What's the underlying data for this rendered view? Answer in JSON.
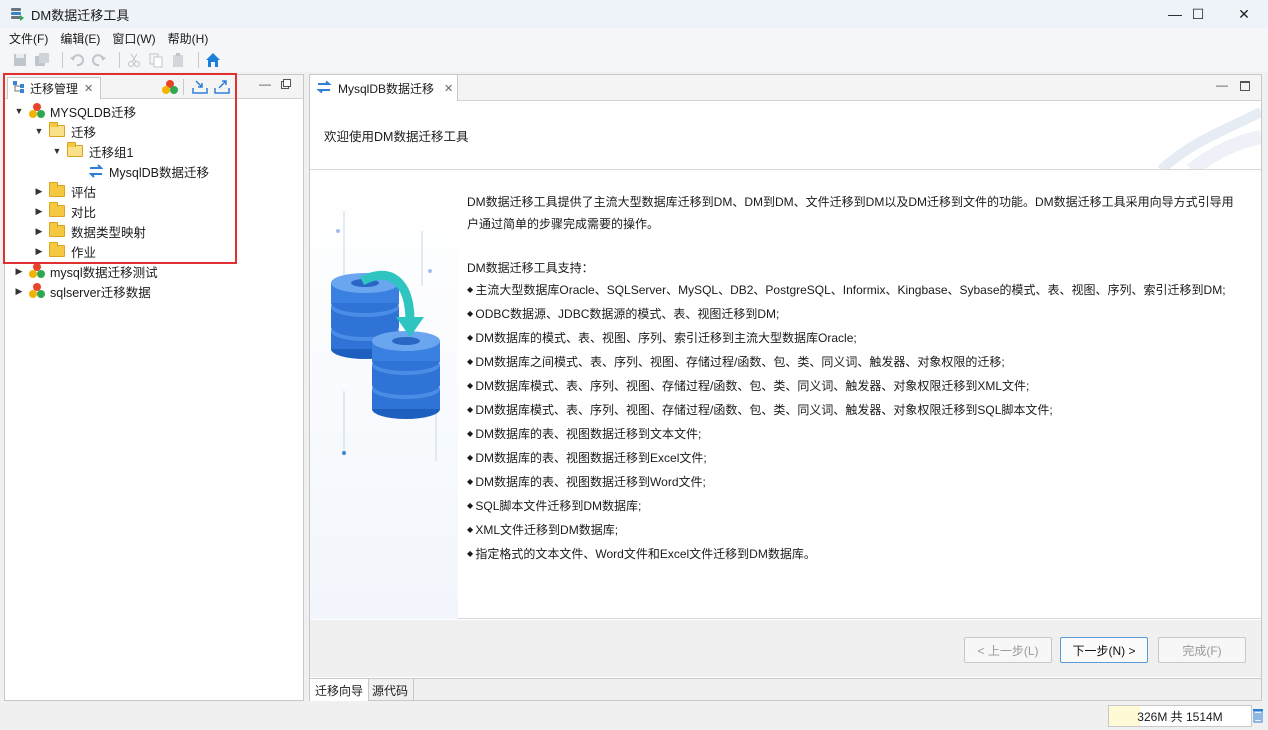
{
  "window": {
    "title": "DM数据迁移工具",
    "controls": {
      "minimize": "—",
      "maximize": "☐",
      "close": "✕"
    }
  },
  "menu": [
    "文件(F)",
    "编辑(E)",
    "窗口(W)",
    "帮助(H)"
  ],
  "left_panel": {
    "tab_label": "迁移管理",
    "tree": [
      {
        "label": "MYSQLDB迁移"
      },
      {
        "label": "迁移"
      },
      {
        "label": "迁移组1"
      },
      {
        "label": "MysqlDB数据迁移"
      },
      {
        "label": "评估"
      },
      {
        "label": "对比"
      },
      {
        "label": "数据类型映射"
      },
      {
        "label": "作业"
      },
      {
        "label": "mysql数据迁移测试"
      },
      {
        "label": "sqlserver迁移数据"
      }
    ]
  },
  "editor": {
    "tab_label": "MysqlDB数据迁移",
    "welcome_title": "欢迎使用DM数据迁移工具",
    "intro_lines": [
      "DM数据迁移工具提供了主流大型数据库迁移到DM、DM到DM、文件迁移到DM以及DM迁移到文件的功能。DM数据迁移工具采用向导方式引导用",
      "户通过简单的步骤完成需要的操作。"
    ],
    "support_title": "DM数据迁移工具支持：",
    "support_items": [
      "主流大型数据库Oracle、SQLServer、MySQL、DB2、PostgreSQL、Informix、Kingbase、Sybase的模式、表、视图、序列、索引迁移到DM;",
      "ODBC数据源、JDBC数据源的模式、表、视图迁移到DM;",
      "DM数据库的模式、表、视图、序列、索引迁移到主流大型数据库Oracle;",
      "DM数据库之间模式、表、序列、视图、存储过程/函数、包、类、同义词、触发器、对象权限的迁移;",
      "DM数据库模式、表、序列、视图、存储过程/函数、包、类、同义词、触发器、对象权限迁移到XML文件;",
      "DM数据库模式、表、序列、视图、存储过程/函数、包、类、同义词、触发器、对象权限迁移到SQL脚本文件;",
      "DM数据库的表、视图数据迁移到文本文件;",
      "DM数据库的表、视图数据迁移到Excel文件;",
      "DM数据库的表、视图数据迁移到Word文件;",
      "SQL脚本文件迁移到DM数据库;",
      "XML文件迁移到DM数据库;",
      "指定格式的文本文件、Word文件和Excel文件迁移到DM数据库。"
    ],
    "buttons": {
      "prev": "< 上一步(L)",
      "next": "下一步(N) >",
      "finish": "完成(F)"
    },
    "bottom_tabs": [
      "迁移向导",
      "源代码"
    ]
  },
  "status": {
    "heap": "326M 共 1514M"
  },
  "colors": {
    "accent": "#2f7fd6",
    "highlight_box": "#e03131",
    "folder": "#f5c842"
  }
}
